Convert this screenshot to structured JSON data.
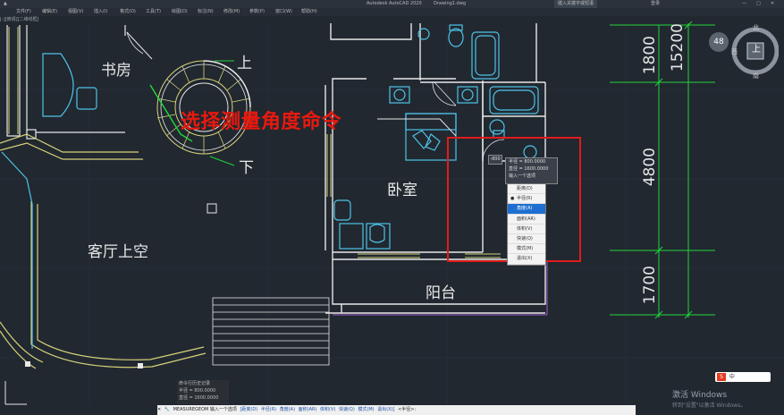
{
  "titlebar": {
    "app_title": "Autodesk AutoCAD 2020",
    "file_name": "Drawing1.dwg",
    "search_placeholder": "键入关键字或短语",
    "user": "登录"
  },
  "menu": [
    "文件(F)",
    "编辑(E)",
    "视图(V)",
    "插入(I)",
    "格式(O)",
    "工具(T)",
    "绘图(D)",
    "标注(N)",
    "修改(M)",
    "参数(P)",
    "窗口(W)",
    "帮助(H)"
  ],
  "viewport_tab": "[-][俯视][二维线框]",
  "rooms": {
    "study": "书房",
    "living_upper": "客厅上空",
    "bedroom": "卧室",
    "balcony": "阳台",
    "up": "上",
    "down": "下"
  },
  "dimensions": {
    "d1": "1800",
    "d2": "15200",
    "d3": "4800",
    "d4": "1700"
  },
  "annotation": "选择测量角度命令",
  "tooltip": {
    "cursor_value": "-800",
    "line1": "半径 = 800.0000",
    "line2": "直径 = 1600.0000",
    "line3": "输入一个选项"
  },
  "context_menu": {
    "items": [
      "距离(D)",
      "半径(R)",
      "角度(A)",
      "面积(AR)",
      "体积(V)",
      "快速(Q)",
      "模式(M)",
      "退出(X)"
    ],
    "selected": "半径(R)",
    "highlighted": "角度(A)"
  },
  "command_history": {
    "title": "命令行历史记录",
    "line1": "半径 = 800.0000",
    "line2": "直径 = 1600.0000"
  },
  "command_line": {
    "prompt": "MEASUREGEOM 输入一个选项",
    "options": [
      "[距离(D)",
      "半径(R)",
      "角度(A)",
      "面积(AR)",
      "体积(V)",
      "快速(Q)",
      "模式(M)",
      "退出(X)]"
    ],
    "tail": "<半径>:"
  },
  "viewcube": {
    "north": "北",
    "south": "南",
    "west": "西",
    "top": "上",
    "level": "48"
  },
  "watermark": {
    "title": "激活 Windows",
    "subtitle": "转到\"设置\"以激活 Windows。"
  },
  "ime": "中"
}
